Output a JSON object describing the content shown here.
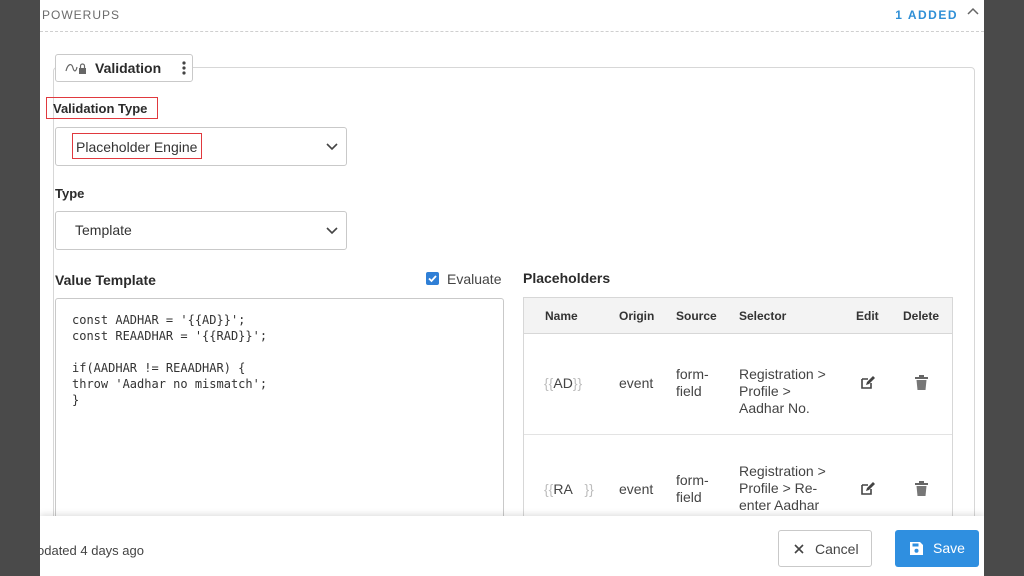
{
  "header": {
    "section_title": "POWERUPS",
    "added_count": "1 ADDED"
  },
  "powerup": {
    "title": "Validation"
  },
  "validation_type": {
    "label": "Validation Type",
    "selected": "Placeholder Engine"
  },
  "type": {
    "label": "Type",
    "selected": "Template"
  },
  "value_template": {
    "label": "Value Template",
    "evaluate_label": "Evaluate",
    "evaluate_checked": true,
    "code_lines": [
      "const AADHAR = '{{AD}}';",
      "const REAADHAR = '{{RAD}}';",
      "",
      "if(AADHAR != REAADHAR) {",
      "throw 'Aadhar no mismatch';",
      "}"
    ]
  },
  "placeholders": {
    "label": "Placeholders",
    "columns": {
      "name": "Name",
      "origin": "Origin",
      "source": "Source",
      "selector": "Selector",
      "edit": "Edit",
      "delete": "Delete"
    },
    "rows": [
      {
        "name": "AD",
        "origin": "event",
        "source_line1": "form-",
        "source_line2": "field",
        "selector_line1": "Registration >",
        "selector_line2": "Profile >",
        "selector_line3": "Aadhar No."
      },
      {
        "name": "RA",
        "origin": "event",
        "source_line1": "form-",
        "source_line2": "field",
        "selector_line1": "Registration >",
        "selector_line2": "Profile > Re-",
        "selector_line3": "enter Aadhar"
      }
    ]
  },
  "footer": {
    "updated_text": "odated 4 days ago",
    "cancel_label": "Cancel",
    "save_label": "Save"
  },
  "colors": {
    "accent": "#2f8fe0",
    "highlight_border": "#e0393e",
    "checkbox": "#2f7fd6"
  }
}
